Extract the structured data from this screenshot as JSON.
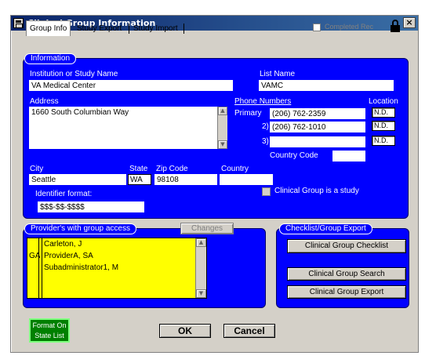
{
  "window": {
    "title": "Clinical Group Information",
    "close": "×"
  },
  "tabs": [
    {
      "label": "Group Info",
      "active": true
    },
    {
      "label": "Study Export",
      "active": false
    },
    {
      "label": "Study Import",
      "active": false
    }
  ],
  "completed_rec": {
    "label": "Completed Rec",
    "checked": false
  },
  "information": {
    "section_label": "Information",
    "institution_label": "Institution or Study Name",
    "institution_value": "VA Medical Center",
    "list_name_label": "List Name",
    "list_name_value": "VAMC",
    "address_label": "Address",
    "address_value": "1660 South Columbian Way",
    "phone_numbers_label": "Phone Numbers",
    "location_label": "Location",
    "phones": [
      {
        "label": "Primary",
        "value": "(206) 762-2359",
        "location": "N.D."
      },
      {
        "label": "2)",
        "value": "(206) 762-1010",
        "location": "N.D."
      },
      {
        "label": "3)",
        "value": "",
        "location": "N.D."
      }
    ],
    "country_code_label": "Country Code",
    "country_code_value": "",
    "city_label": "City",
    "city_value": "Seattle",
    "state_label": "State",
    "state_value": "WA",
    "zip_label": "Zip Code",
    "zip_value": "98108",
    "country_label": "Country",
    "country_value": "",
    "identifier_label": "Identifier format:",
    "identifier_value": "$$$-$$-$$$$",
    "is_study_label": "Clinical Group is a study",
    "is_study_checked": false
  },
  "providers": {
    "section_label": "Provider's with group access",
    "changes_button": "Changes",
    "rows": [
      {
        "code": "",
        "name": "Carleton, J"
      },
      {
        "code": "GA",
        "name": "ProviderA, SA"
      },
      {
        "code": "",
        "name": "Subadministrator1, M"
      }
    ]
  },
  "export": {
    "section_label": "Checklist/Group Export",
    "checklist_button": "Clinical Group Checklist",
    "search_button": "Clinical Group Search",
    "export_button": "Clinical Group Export"
  },
  "footer": {
    "format_line1": "Format On",
    "format_line2": "State List",
    "ok_label": "OK",
    "cancel_label": "Cancel"
  },
  "colors": {
    "panel": "#0000ff",
    "provider_list": "#ffff00",
    "format_button": "#008000"
  }
}
